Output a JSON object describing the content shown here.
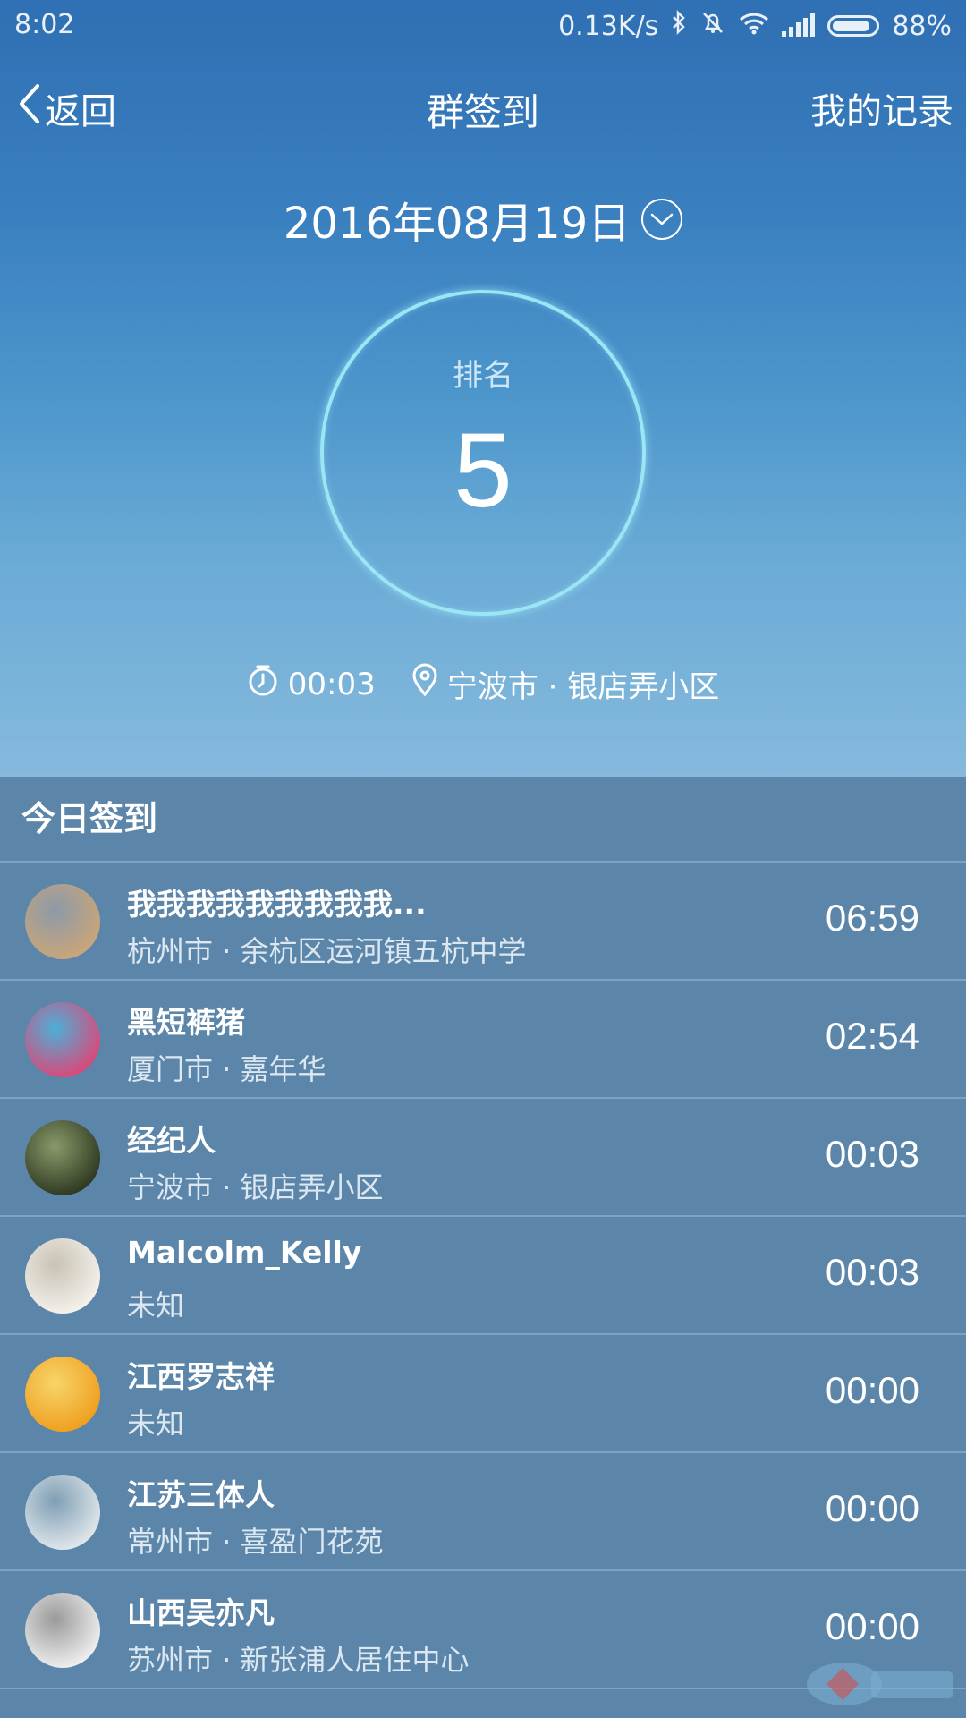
{
  "status_bar": {
    "time": "8:02",
    "net_speed": "0.13K/s",
    "battery": "88%",
    "battery_level": 0.88,
    "icons": [
      "bluetooth-icon",
      "mute-icon",
      "wifi-icon",
      "signal-icon",
      "battery-icon"
    ]
  },
  "nav": {
    "back_label": "返回",
    "title": "群签到",
    "records_label": "我的记录"
  },
  "date": {
    "value": "2016年08月19日"
  },
  "rank": {
    "label": "排名",
    "value": "5"
  },
  "checkin_info": {
    "time": "00:03",
    "location": "宁波市 · 银店弄小区"
  },
  "list": {
    "header": "今日签到",
    "items": [
      {
        "name": "我我我我我我我我我...",
        "location": "杭州市 · 余杭区运河镇五杭中学",
        "time": "06:59",
        "avatar_colors": [
          "#c9a57a",
          "#8d9aa8"
        ]
      },
      {
        "name": "黑短裤猪",
        "location": "厦门市 · 嘉年华",
        "time": "02:54",
        "avatar_colors": [
          "#d84a7a",
          "#4bb0d8"
        ]
      },
      {
        "name": "经纪人",
        "location": "宁波市 · 银店弄小区",
        "time": "00:03",
        "avatar_colors": [
          "#2f3a22",
          "#8a9a6a"
        ]
      },
      {
        "name": "Malcolm_Kelly",
        "location": "未知",
        "time": "00:03",
        "avatar_colors": [
          "#f4f1ea",
          "#c9c2b5"
        ]
      },
      {
        "name": "江西罗志祥",
        "location": "未知",
        "time": "00:00",
        "avatar_colors": [
          "#f0a020",
          "#f6d56a"
        ]
      },
      {
        "name": "江苏三体人",
        "location": "常州市 · 喜盈门花苑",
        "time": "00:00",
        "avatar_colors": [
          "#dfe6ea",
          "#7f9fb5"
        ]
      },
      {
        "name": "山西吴亦凡",
        "location": "苏州市 · 新张浦人居住中心",
        "time": "00:00",
        "avatar_colors": [
          "#eeeeee",
          "#9a9a9a"
        ]
      }
    ]
  },
  "colors": {
    "hero_top": "#2f6fb3",
    "hero_bottom": "#86b9dc",
    "list_bg": "#5b85a9",
    "circle_stroke": "#9be6f5"
  }
}
